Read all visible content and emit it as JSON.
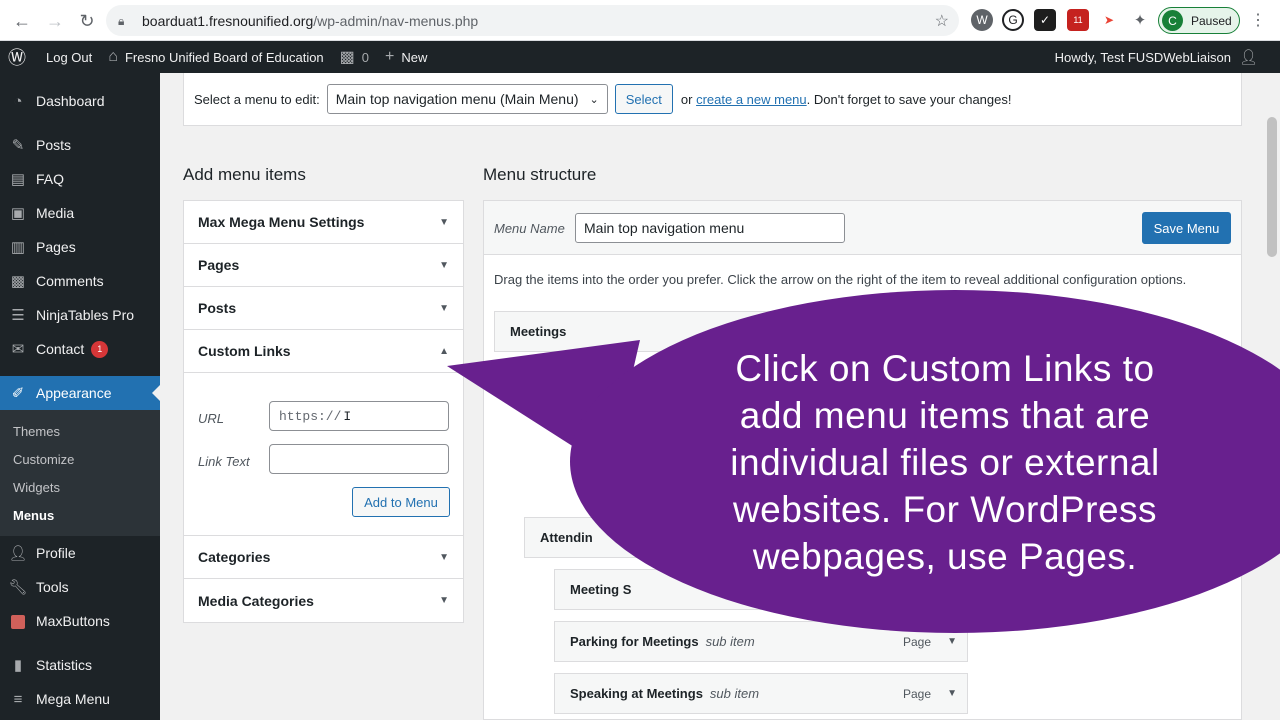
{
  "browser": {
    "url_domain": "boarduat1.fresnounified.org",
    "url_path": "/wp-admin/nav-menus.php",
    "profile_initial": "C",
    "profile_status": "Paused",
    "ext_badge": "11"
  },
  "adminbar": {
    "logout": "Log Out",
    "site_name": "Fresno Unified Board of Education",
    "comments_count": "0",
    "new_label": "New",
    "howdy": "Howdy, Test FUSDWebLiaison"
  },
  "sidebar": {
    "items": [
      {
        "label": "Dashboard"
      },
      {
        "label": "Posts"
      },
      {
        "label": "FAQ"
      },
      {
        "label": "Media"
      },
      {
        "label": "Pages"
      },
      {
        "label": "Comments"
      },
      {
        "label": "NinjaTables Pro"
      },
      {
        "label": "Contact",
        "badge": "1"
      },
      {
        "label": "Appearance"
      },
      {
        "label": "Profile"
      },
      {
        "label": "Tools"
      },
      {
        "label": "MaxButtons"
      },
      {
        "label": "Statistics"
      },
      {
        "label": "Mega Menu"
      }
    ],
    "submenu": [
      "Themes",
      "Customize",
      "Widgets",
      "Menus"
    ]
  },
  "manage": {
    "prompt": "Select a menu to edit:",
    "selected_menu": "Main top navigation menu (Main Menu)",
    "select_button": "Select",
    "or_text": "or",
    "create_link": "create a new menu",
    "reminder": ". Don't forget to save your changes!"
  },
  "add_items": {
    "title": "Add menu items",
    "sections": [
      "Max Mega Menu Settings",
      "Pages",
      "Posts",
      "Custom Links"
    ],
    "after_sections": [
      "Categories",
      "Media Categories"
    ],
    "url_label": "URL",
    "url_placeholder": "https://",
    "link_text_label": "Link Text",
    "add_button": "Add to Menu"
  },
  "structure": {
    "title": "Menu structure",
    "name_label": "Menu Name",
    "name_value": "Main top navigation menu",
    "save_button": "Save Menu",
    "instructions": "Drag the items into the order you prefer. Click the arrow on the right of the item to reveal additional configuration options.",
    "items": [
      {
        "label": "Meetings",
        "subtag": "",
        "type": ""
      },
      {
        "label": "Attendin",
        "subtag": "",
        "type": ""
      },
      {
        "label": "Meeting S",
        "subtag": "",
        "type": ""
      },
      {
        "label": "Parking for Meetings",
        "subtag": "sub item",
        "type": "Page"
      },
      {
        "label": "Speaking at Meetings",
        "subtag": "sub item",
        "type": "Page"
      }
    ]
  },
  "callout": {
    "lines": [
      "Click on Custom Links to",
      "add menu items that are",
      "individual files or external",
      "websites. For WordPress",
      "webpages, use Pages."
    ]
  },
  "colors": {
    "accent": "#2271b1",
    "callout": "#68208e",
    "adminbar": "#1d2327"
  }
}
